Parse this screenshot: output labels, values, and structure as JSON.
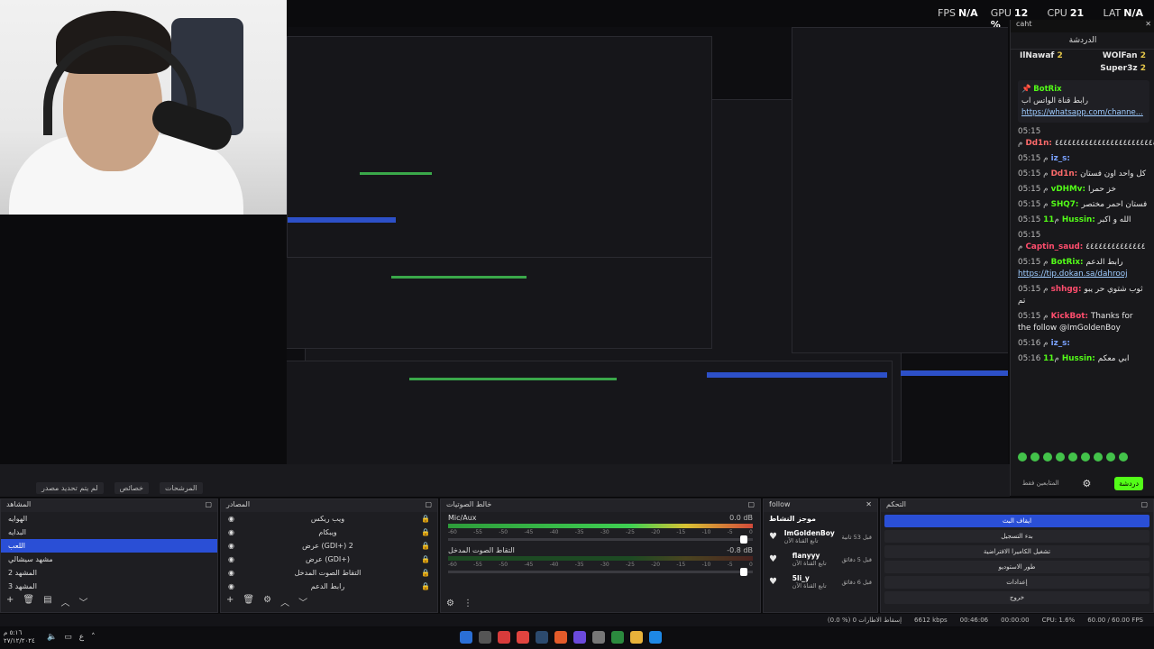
{
  "stats": {
    "fps_label": "FPS",
    "fps_value": "N/A",
    "gpu_label": "GPU",
    "gpu_value": "12 %",
    "cpu_label": "CPU",
    "cpu_value": "21 %",
    "lat_label": "LAT",
    "lat_value": "N/A"
  },
  "chat": {
    "window_title": "caht",
    "header": "الدردشة",
    "gifters": [
      {
        "name": "IlNawaf",
        "count": "2"
      },
      {
        "name": "WOlFan",
        "count": "2"
      },
      {
        "name": "Super3z",
        "count": "2"
      }
    ],
    "pinned": {
      "user": "BotRix",
      "text": "رابط قناة الواتس اب",
      "link": "https://whatsapp.com/channe..."
    },
    "messages": [
      {
        "time": "05:15 م",
        "user": "Dd1n:",
        "color": "#ff6b6b",
        "text": "٤٤٤٤٤٤٤٤٤٤٤٤٤٤٤٤٤٤٤٤٤٤٤٤٤"
      },
      {
        "time": "05:15 م",
        "user": "iz_s:",
        "color": "#7aa2ff",
        "text": ""
      },
      {
        "time": "05:15 م",
        "user": "Dd1n:",
        "color": "#ff6b6b",
        "text": "كل واحد اون فستان"
      },
      {
        "time": "05:15 م",
        "user": "vDHMv:",
        "color": "#53fc18",
        "text": "خز حمرا"
      },
      {
        "time": "05:15 م",
        "user": "SHQ7:",
        "color": "#53fc18",
        "text": "فستان احمر مختصر"
      },
      {
        "time": "05:15 م",
        "user": "11Hussin:",
        "color": "#53fc18",
        "text": "الله و اكبر"
      },
      {
        "time": "05:15 م",
        "user": "Captin_saud:",
        "color": "#ff4d6d",
        "text": "٤٤٤٤٤٤٤٤٤٤٤٤٤٤"
      },
      {
        "time": "05:15 م",
        "user": "BotRix:",
        "color": "#53fc18",
        "text": "رابط الدعم",
        "link": "https://tip.dokan.sa/dahrooj"
      },
      {
        "time": "05:15 م",
        "user": "shhgg:",
        "color": "#ff4d6d",
        "text": "ثوب شتوي حر يبو تم"
      },
      {
        "time": "05:15 م",
        "user": "KickBot:",
        "color": "#ff4d6d",
        "text": "Thanks for the follow @ImGoldenBoy"
      },
      {
        "time": "05:16 م",
        "user": "iz_s:",
        "color": "#7aa2ff",
        "text": ""
      },
      {
        "time": "05:16 م",
        "user": "11Hussin:",
        "color": "#53fc18",
        "text": "ابي معكم"
      }
    ],
    "footer_label": "المتابعين فقط",
    "send_label": "دردشة"
  },
  "obs": {
    "tabs": [
      "لم يتم تحديد مصدر",
      "خصائص",
      "المرشحات"
    ],
    "scenes": {
      "title": "المشاهد",
      "items": [
        "الهوايه",
        "البدايه",
        "اللعب",
        "مشهد سيشالي",
        "المشهد 2",
        "المشهد 3"
      ],
      "selected_index": 2
    },
    "sources": {
      "title": "المصادر",
      "items": [
        "ويب ريكس",
        "ويبكام",
        "عرض (GDI+) 2",
        "عرض (GDI+)",
        "التقاط الصوت المدخل",
        "رابط الدعم"
      ]
    },
    "mixer": {
      "title": "خالط الصوتيات",
      "channels": [
        {
          "name": "Mic/Aux",
          "db": "0.0 dB",
          "level": 0.82
        },
        {
          "name": "التقاط الصوت المدخل",
          "db": "-0.8 dB",
          "level": 0.0
        }
      ],
      "scale": [
        "-60",
        "-55",
        "-50",
        "-45",
        "-40",
        "-35",
        "-30",
        "-25",
        "-20",
        "-15",
        "-10",
        "-5",
        "0"
      ]
    },
    "follow": {
      "title": "follow",
      "header": "موجز النشاط",
      "items": [
        {
          "name": "ImGoldenBoy",
          "sub": "تابع القناة الآن",
          "time": "قبل 53 ثانية"
        },
        {
          "name": "flanyyy",
          "sub": "تابع القناة الآن",
          "time": "قبل 5 دقائق"
        },
        {
          "name": "5li_y",
          "sub": "تابع القناة الآن",
          "time": "قبل 6 دقائق"
        }
      ]
    },
    "controls": {
      "title": "التحكم",
      "buttons": [
        "ايقاف البث",
        "بدء التسجيل",
        "تشغيل الكاميرا الافتراضية",
        "طور الاستوديو",
        "إعدادات",
        "خروج"
      ]
    },
    "status": {
      "dropped": "(0.0 %) 0",
      "dropped_label": "إسقاط الاطارات",
      "kbps": "6612 kbps",
      "live_time": "00:46:06",
      "rec_time": "00:00:00",
      "cpu": "CPU: 1.6%",
      "fps": "60.00 / 60.00 FPS"
    }
  },
  "taskbar": {
    "time": "٥:١٦ م",
    "date": "٢٧/١٢/٢٠٢٤",
    "lang": "ع"
  },
  "colors": {
    "accent": "#2a4fd6",
    "kick_green": "#53fc18",
    "meter_green": "#3fd052"
  }
}
